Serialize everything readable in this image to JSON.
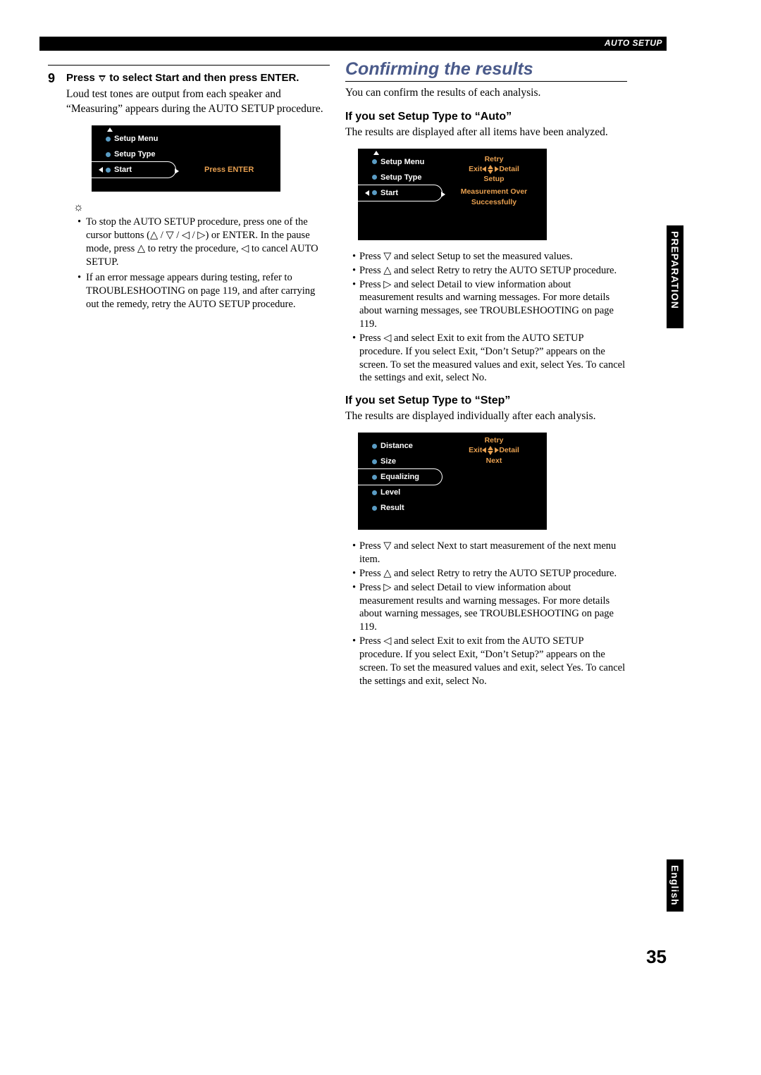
{
  "header": {
    "section": "AUTO SETUP"
  },
  "side_tabs": {
    "preparation": "PREPARATION",
    "english": "English"
  },
  "page_number": "35",
  "left": {
    "step_number": "9",
    "step_title_before": "Press ",
    "step_title_after": " to select Start and then press ENTER.",
    "body": "Loud test tones are output from each speaker and “Measuring” appears during the AUTO SETUP procedure.",
    "screen": {
      "items": [
        "Setup Menu",
        "Setup Type",
        "Start"
      ],
      "right_label": "Press ENTER"
    },
    "notes": [
      "To stop the AUTO SETUP procedure, press one of the cursor buttons (△ / ▽ / ◁ / ▷) or ENTER. In the pause mode, press △ to retry the procedure, ◁ to cancel AUTO SETUP.",
      "If an error message appears during testing, refer to TROUBLESHOOTING on page 119, and after carrying out the remedy, retry the AUTO SETUP procedure."
    ]
  },
  "right": {
    "title": "Confirming the results",
    "intro": "You can confirm the results of each analysis.",
    "auto": {
      "heading": "If you set Setup Type to “Auto”",
      "body": "The results are displayed after all items have been analyzed.",
      "screen": {
        "items": [
          "Setup Menu",
          "Setup Type",
          "Start"
        ],
        "nav": {
          "up": "Retry",
          "left": "Exit",
          "right": "Detail",
          "down": "Setup"
        },
        "status1": "Measurement Over",
        "status2": "Successfully"
      },
      "bullets": [
        "Press ▽ and select Setup to set the measured values.",
        "Press △ and select Retry to retry the AUTO SETUP procedure.",
        "Press ▷ and select Detail to view information about measurement results and warning messages. For more details about warning messages, see TROUBLESHOOTING on page 119.",
        "Press ◁ and select Exit to exit from the AUTO SETUP procedure. If you select Exit, “Don’t Setup?” appears on the screen. To set the measured values and exit, select Yes. To cancel the settings and exit, select No."
      ]
    },
    "step": {
      "heading": "If you set Setup Type to “Step”",
      "body": "The results are displayed individually after each analysis.",
      "screen": {
        "items": [
          "Distance",
          "Size",
          "Equalizing",
          "Level",
          "Result"
        ],
        "nav": {
          "up": "Retry",
          "left": "Exit",
          "right": "Detail",
          "down": "Next"
        }
      },
      "bullets": [
        "Press ▽ and select Next to start measurement of the next menu item.",
        "Press △ and select Retry to retry the AUTO SETUP procedure.",
        "Press ▷ and select Detail to view information about measurement results and warning messages. For more details about warning messages, see TROUBLESHOOTING on page 119.",
        "Press ◁ and select Exit to exit from the AUTO SETUP procedure. If you select Exit, “Don’t Setup?” appears on the screen. To set the measured values and exit, select Yes. To cancel the settings and exit, select No."
      ]
    }
  }
}
